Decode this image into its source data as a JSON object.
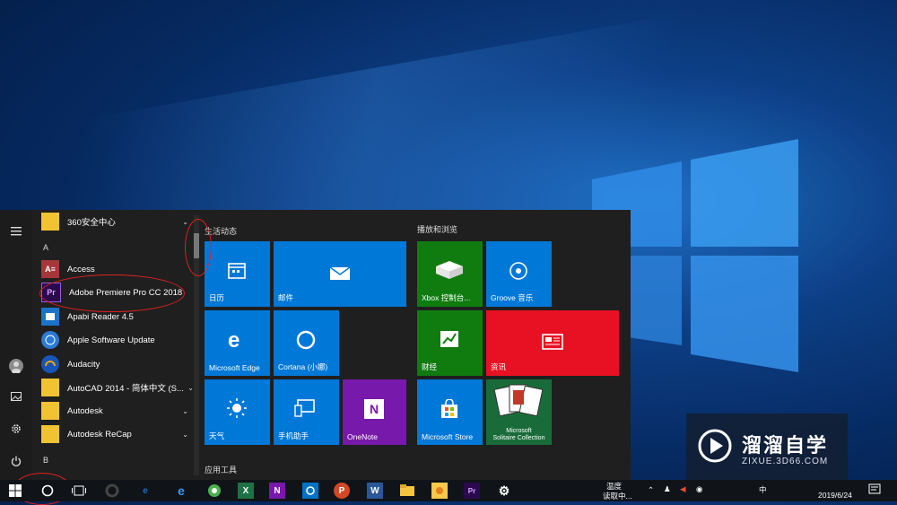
{
  "start_menu": {
    "apps": [
      {
        "label": "360安全中心",
        "kind": "folder",
        "chevron": "⌄"
      },
      {
        "label": "A",
        "kind": "letter"
      },
      {
        "label": "Access",
        "kind": "app",
        "icon": "A≡",
        "color": "#a4373a"
      },
      {
        "label": "Adobe Premiere Pro CC 2018",
        "kind": "app",
        "icon": "Pr",
        "color": "#2a0a4d"
      },
      {
        "label": "Apabi Reader 4.5",
        "kind": "app",
        "icon": "reader-icon",
        "color": "#1a73c9"
      },
      {
        "label": "Apple Software Update",
        "kind": "app",
        "icon": "apple-update-icon",
        "color": "#2a7ad6"
      },
      {
        "label": "Audacity",
        "kind": "app",
        "icon": "audacity-icon",
        "color": "#1756b8"
      },
      {
        "label": "AutoCAD 2014 - 简体中文 (S...",
        "kind": "folder",
        "chevron": "⌄"
      },
      {
        "label": "Autodesk",
        "kind": "folder",
        "chevron": "⌄"
      },
      {
        "label": "Autodesk ReCap",
        "kind": "folder",
        "chevron": "⌄"
      },
      {
        "label": "B",
        "kind": "letter"
      }
    ],
    "groups": {
      "life": "生活动态",
      "play": "播放和浏览",
      "tools": "应用工具"
    },
    "tiles": {
      "calendar": "日历",
      "mail": "邮件",
      "xbox": "Xbox 控制台...",
      "groove": "Groove 音乐",
      "edge": "Microsoft Edge",
      "cortana": "Cortana (小娜)",
      "finance": "财经",
      "news": "资讯",
      "weather": "天气",
      "phone": "手机助手",
      "onenote": "OneNote",
      "store": "Microsoft Store",
      "solitaire_line1": "Microsoft",
      "solitaire_line2": "Solitaire Collection"
    }
  },
  "taskbar": {
    "tray_text1": "温度",
    "tray_text2": "读取中...",
    "date": "2019/6/24",
    "ime": "中",
    "apps": [
      "e",
      "",
      "X",
      "N",
      "",
      "P",
      "W",
      "",
      "",
      "Pr",
      "⚙"
    ]
  },
  "colors": {
    "tile_blue": "#0078d7",
    "xbox_green": "#107c10",
    "news_red": "#e81123",
    "onenote_purple": "#7719aa",
    "annotation_red": "#e02020"
  },
  "watermark": {
    "brand": "溜溜自学",
    "url": "ZIXUE.3D66.COM"
  }
}
